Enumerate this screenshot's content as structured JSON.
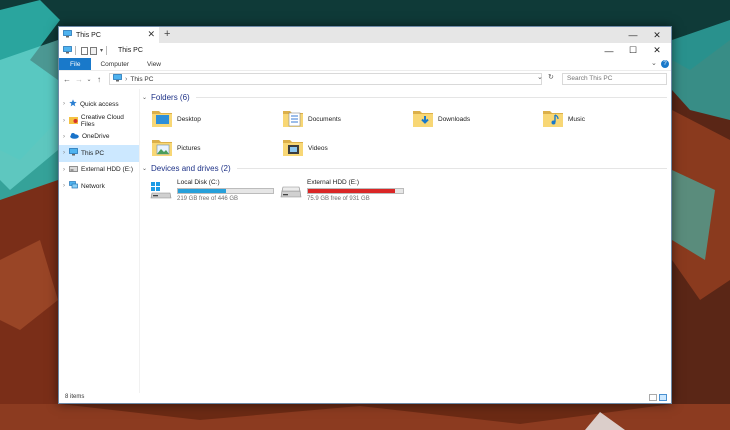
{
  "window": {
    "tab_title": "This PC",
    "tab_close": "✕",
    "new_tab": "+",
    "qat_title": "This PC",
    "minimize": "—",
    "maximize": "☐",
    "close": "✕",
    "ribbon_collapse": "⌄"
  },
  "ribbon": {
    "tabs": [
      "File",
      "Computer",
      "View"
    ],
    "help": "?"
  },
  "address": {
    "back": "←",
    "forward": "→",
    "recent": "⌄",
    "up": "↑",
    "crumb_sep": "›",
    "crumb": "This PC",
    "dropdown": "⌄",
    "refresh": "↻",
    "search_placeholder": "Search This PC"
  },
  "nav": {
    "items": [
      {
        "label": "Quick access",
        "icon": "star-icon"
      },
      {
        "label": "Creative Cloud Files",
        "icon": "creative-cloud-folder-icon"
      },
      {
        "label": "OneDrive",
        "icon": "cloud-icon"
      },
      {
        "label": "This PC",
        "icon": "computer-icon",
        "selected": true
      },
      {
        "label": "External HDD (E:)",
        "icon": "drive-icon"
      },
      {
        "label": "Network",
        "icon": "network-icon"
      }
    ]
  },
  "folders_group": {
    "title": "Folders (6)",
    "items": [
      {
        "label": "Desktop",
        "icon": "desktop-folder-icon"
      },
      {
        "label": "Documents",
        "icon": "documents-folder-icon"
      },
      {
        "label": "Downloads",
        "icon": "downloads-folder-icon"
      },
      {
        "label": "Music",
        "icon": "music-folder-icon"
      },
      {
        "label": "Pictures",
        "icon": "pictures-folder-icon"
      },
      {
        "label": "Videos",
        "icon": "videos-folder-icon"
      }
    ]
  },
  "drives_group": {
    "title": "Devices and drives (2)",
    "items": [
      {
        "label": "Local Disk (C:)",
        "free": "219 GB free of 446 GB",
        "used_fraction": 0.51,
        "bar_color": "#26a0da",
        "icon": "windows-drive-icon"
      },
      {
        "label": "External HDD (E:)",
        "free": "75.9 GB free of 931 GB",
        "used_fraction": 0.92,
        "bar_color": "#da2626",
        "icon": "drive-icon"
      }
    ]
  },
  "status": {
    "count": "8 items"
  },
  "colors": {
    "accent": "#1979ca",
    "selection": "#cce8ff",
    "group_heading": "#1e3287"
  }
}
